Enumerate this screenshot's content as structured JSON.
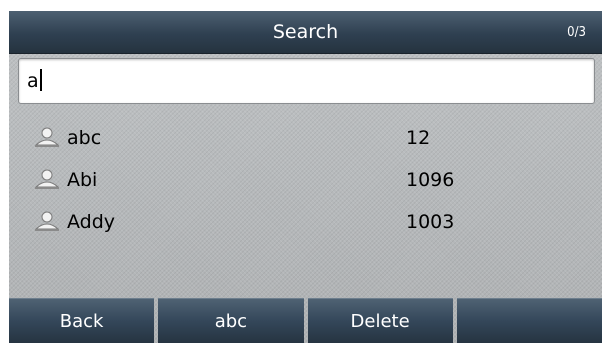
{
  "header": {
    "title": "Search",
    "counter": "0/3"
  },
  "search": {
    "value": "a"
  },
  "results": [
    {
      "name": "abc",
      "number": "12"
    },
    {
      "name": "Abi",
      "number": "1096"
    },
    {
      "name": "Addy",
      "number": "1003"
    }
  ],
  "softkeys": {
    "key1": "Back",
    "key2": "abc",
    "key3": "Delete",
    "key4": ""
  },
  "icons": {
    "contact": "person-icon"
  },
  "colors": {
    "bar_dark": "#2f4051",
    "background": "#b6b9bb"
  }
}
